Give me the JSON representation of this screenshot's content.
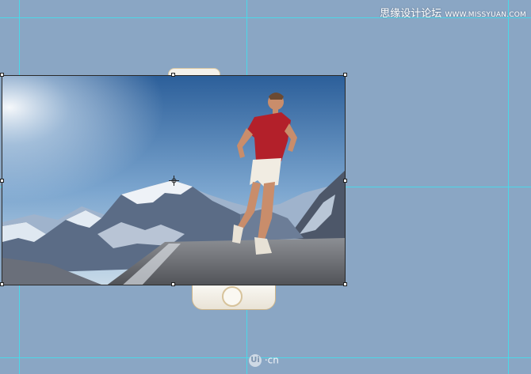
{
  "watermark": {
    "title": "思缘设计论坛",
    "site": "WWW.MISSYUAN.COM"
  },
  "logo": {
    "mark": "Ui",
    "suffix": "·cn"
  },
  "colors": {
    "background": "#8aa6c4",
    "guides": "#3ee0ef",
    "shirt": "#b3202a"
  },
  "icons": {
    "move_cursor": "crosshair-icon",
    "home_button": "home-button-icon"
  }
}
